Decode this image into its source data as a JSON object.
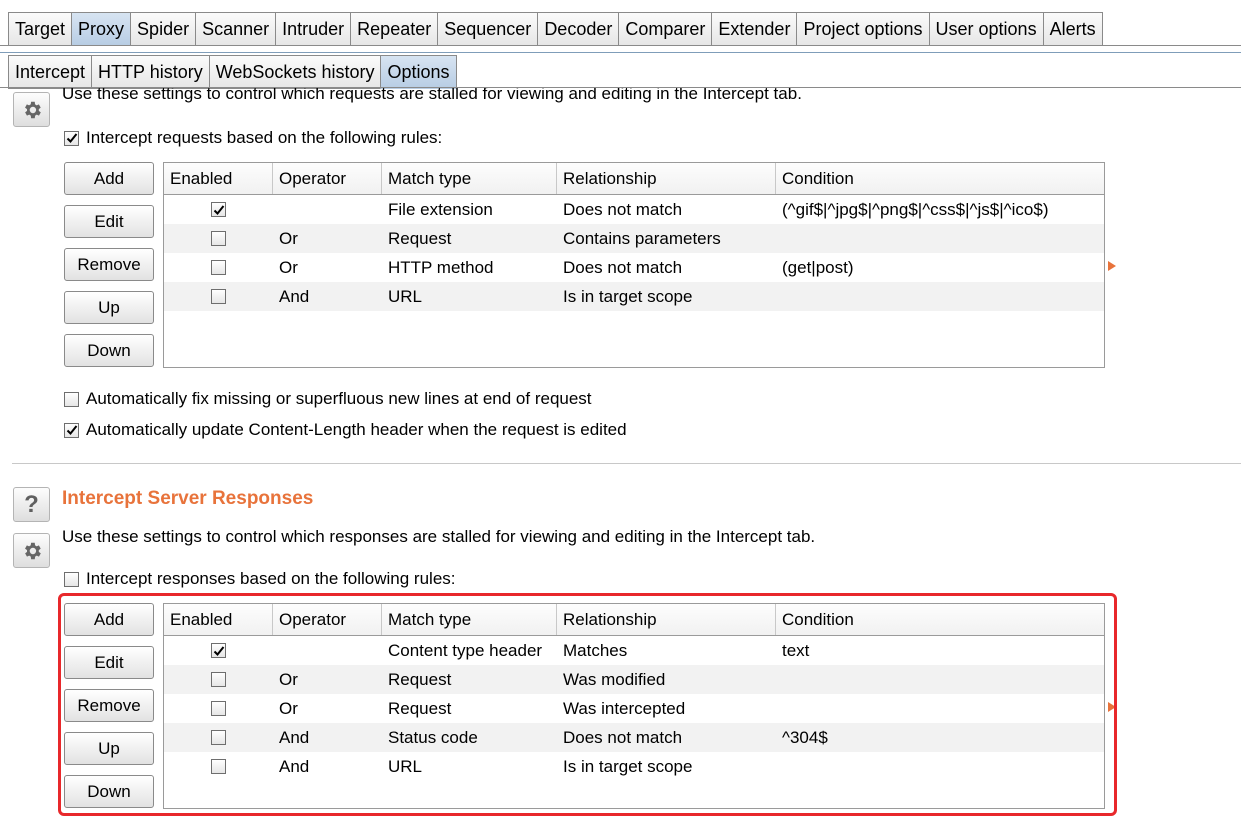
{
  "main_tabs": [
    {
      "label": "Target"
    },
    {
      "label": "Proxy",
      "active": true
    },
    {
      "label": "Spider"
    },
    {
      "label": "Scanner"
    },
    {
      "label": "Intruder"
    },
    {
      "label": "Repeater"
    },
    {
      "label": "Sequencer"
    },
    {
      "label": "Decoder"
    },
    {
      "label": "Comparer"
    },
    {
      "label": "Extender"
    },
    {
      "label": "Project options"
    },
    {
      "label": "User options"
    },
    {
      "label": "Alerts"
    }
  ],
  "sub_tabs": [
    {
      "label": "Intercept"
    },
    {
      "label": "HTTP history"
    },
    {
      "label": "WebSockets history"
    },
    {
      "label": "Options",
      "active": true
    }
  ],
  "requests_section": {
    "description": "Use these settings to control which requests are stalled for viewing and editing in the Intercept tab.",
    "intercept_checkbox": {
      "label": "Intercept requests based on the following rules:",
      "checked": true
    },
    "buttons": {
      "add": "Add",
      "edit": "Edit",
      "remove": "Remove",
      "up": "Up",
      "down": "Down"
    },
    "columns": [
      "Enabled",
      "Operator",
      "Match type",
      "Relationship",
      "Condition"
    ],
    "rules": [
      {
        "enabled": true,
        "operator": "",
        "match_type": "File extension",
        "relationship": "Does not match",
        "condition": "(^gif$|^jpg$|^png$|^css$|^js$|^ico$)"
      },
      {
        "enabled": false,
        "operator": "Or",
        "match_type": "Request",
        "relationship": "Contains parameters",
        "condition": ""
      },
      {
        "enabled": false,
        "operator": "Or",
        "match_type": "HTTP method",
        "relationship": "Does not match",
        "condition": "(get|post)"
      },
      {
        "enabled": false,
        "operator": "And",
        "match_type": "URL",
        "relationship": "Is in target scope",
        "condition": ""
      }
    ],
    "fix_newlines": {
      "label": "Automatically fix missing or superfluous new lines at end of request",
      "checked": false
    },
    "update_content_length": {
      "label": "Automatically update Content-Length header when the request is edited",
      "checked": true
    }
  },
  "responses_section": {
    "title": "Intercept Server Responses",
    "help_icon": "?",
    "description": "Use these settings to control which responses are stalled for viewing and editing in the Intercept tab.",
    "intercept_checkbox": {
      "label": "Intercept responses based on the following rules:",
      "checked": false
    },
    "buttons": {
      "add": "Add",
      "edit": "Edit",
      "remove": "Remove",
      "up": "Up",
      "down": "Down"
    },
    "columns": [
      "Enabled",
      "Operator",
      "Match type",
      "Relationship",
      "Condition"
    ],
    "rules": [
      {
        "enabled": true,
        "operator": "",
        "match_type": "Content type header",
        "relationship": "Matches",
        "condition": "text"
      },
      {
        "enabled": false,
        "operator": "Or",
        "match_type": "Request",
        "relationship": "Was modified",
        "condition": ""
      },
      {
        "enabled": false,
        "operator": "Or",
        "match_type": "Request",
        "relationship": "Was intercepted",
        "condition": ""
      },
      {
        "enabled": false,
        "operator": "And",
        "match_type": "Status code",
        "relationship": "Does not match",
        "condition": "^304$"
      },
      {
        "enabled": false,
        "operator": "And",
        "match_type": "URL",
        "relationship": "Is in target scope",
        "condition": ""
      }
    ]
  },
  "colors": {
    "accent": "#e8733b",
    "highlight": "#e8282b",
    "active_tab": "#b8cde4"
  }
}
